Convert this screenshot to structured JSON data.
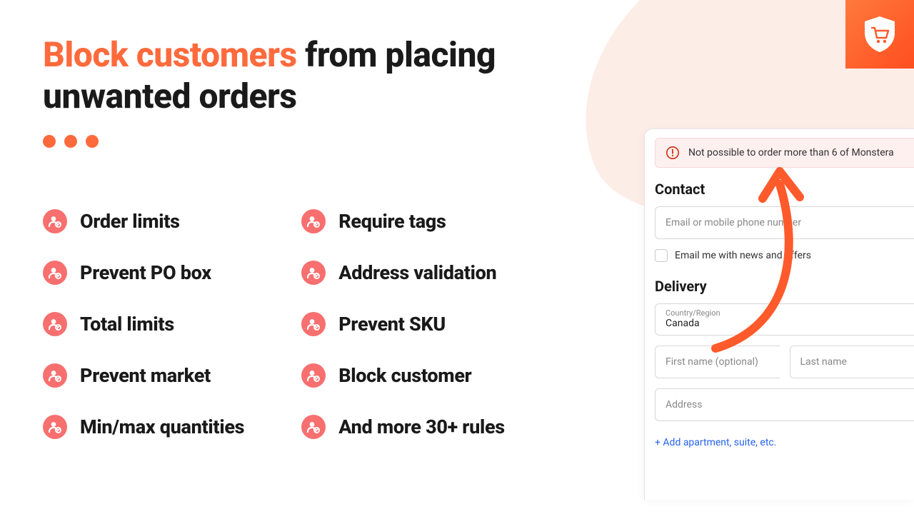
{
  "headline": {
    "accent": "Block customers",
    "rest": " from placing unwanted orders"
  },
  "features_col1": [
    "Order limits",
    "Prevent PO box",
    "Total limits",
    "Prevent market",
    "Min/max quantities"
  ],
  "features_col2": [
    "Require tags",
    "Address validation",
    "Prevent SKU",
    "Block customer",
    "And more 30+ rules"
  ],
  "checkout": {
    "error": "Not possible to order more than 6 of Monstera",
    "contact_heading": "Contact",
    "email_placeholder": "Email or mobile phone number",
    "news_label": "Email me with news and offers",
    "delivery_heading": "Delivery",
    "country_label": "Country/Region",
    "country_value": "Canada",
    "first_name_placeholder": "First name (optional)",
    "last_name_placeholder": "Last name",
    "address_placeholder": "Address",
    "add_apartment": "+  Add apartment, suite, etc."
  }
}
